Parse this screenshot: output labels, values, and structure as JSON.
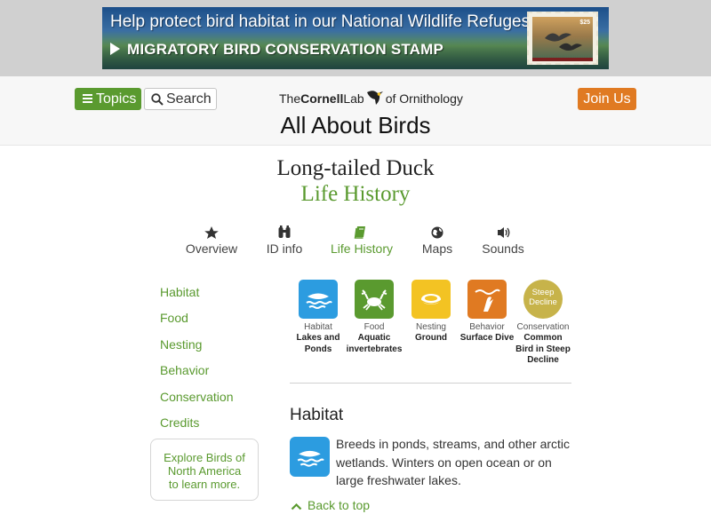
{
  "banner": {
    "headline": "Help protect bird habitat in our National Wildlife Refuges!",
    "cta": "MIGRATORY BIRD CONSERVATION STAMP",
    "stamp_value": "$25"
  },
  "header": {
    "topics_label": "Topics",
    "search_label": "Search",
    "org_pre": "The",
    "org_bold": "Cornell",
    "org_mid": "Lab",
    "org_post": "of Ornithology",
    "site_title": "All About Birds",
    "join_label": "Join Us"
  },
  "species": {
    "name": "Long-tailed Duck",
    "subpage": "Life History"
  },
  "tabs": [
    {
      "label": "Overview",
      "icon": "star-icon"
    },
    {
      "label": "ID info",
      "icon": "binoculars-icon"
    },
    {
      "label": "Life History",
      "icon": "book-icon",
      "active": true
    },
    {
      "label": "Maps",
      "icon": "globe-icon"
    },
    {
      "label": "Sounds",
      "icon": "speaker-icon"
    }
  ],
  "nav": {
    "items": [
      "Habitat",
      "Food",
      "Nesting",
      "Behavior",
      "Conservation",
      "Credits"
    ],
    "explore": [
      "Explore Birds of",
      "North America",
      "to learn more."
    ]
  },
  "summary": [
    {
      "label": "Habitat",
      "value": [
        "Lakes and",
        "Ponds"
      ],
      "icon": "lake-icon",
      "color": "#2c9ce0"
    },
    {
      "label": "Food",
      "value": [
        "Aquatic",
        "invertebrates"
      ],
      "icon": "crab-icon",
      "color": "#5a9a2f"
    },
    {
      "label": "Nesting",
      "value": [
        "Ground"
      ],
      "icon": "nest-icon",
      "color": "#f3c323"
    },
    {
      "label": "Behavior",
      "value": [
        "Surface Dive"
      ],
      "icon": "diving-bird-icon",
      "color": "#e07a22"
    },
    {
      "label": "Conservation",
      "value": [
        "Common",
        "Bird in Steep",
        "Decline"
      ],
      "icon": "steep-decline-badge",
      "color": "#c7b34a",
      "badge": [
        "Steep",
        "Decline"
      ]
    }
  ],
  "habitat": {
    "title": "Habitat",
    "text": "Breeds in ponds, streams, and other arctic wetlands. Winters on open ocean or on large freshwater lakes.",
    "back_to_top": "Back to top"
  },
  "colors": {
    "accent_green": "#5a9a2f",
    "join_orange": "#e07a22",
    "water_blue": "#2c9ce0"
  }
}
